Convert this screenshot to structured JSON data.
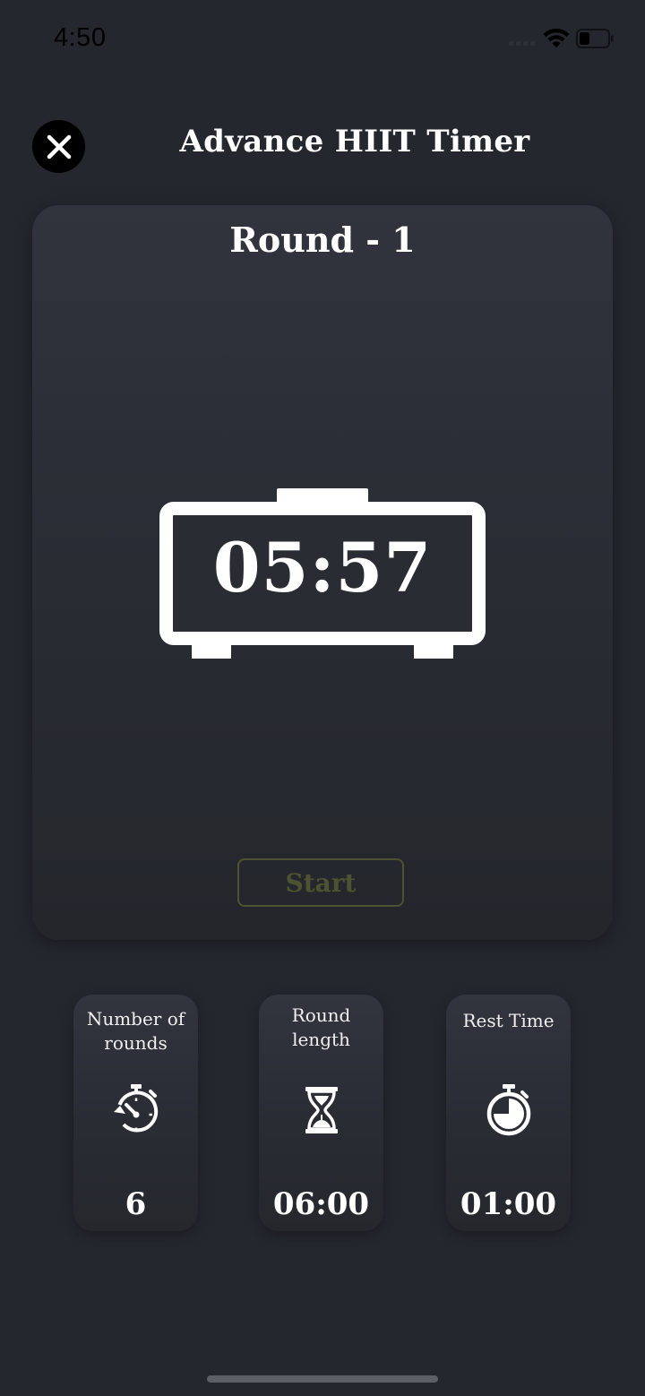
{
  "status_bar": {
    "time": "4:50",
    "wifi_icon": "wifi-icon",
    "battery_icon": "battery-icon",
    "battery_level": 0.3
  },
  "header": {
    "title": "Advance HIIT Timer",
    "close_icon": "close-icon"
  },
  "timer": {
    "round_label": "Round - 1",
    "display": "05:57",
    "clock_icon": "alarm-clock-icon",
    "start_label": "Start",
    "start_color": "#4d5330"
  },
  "settings": [
    {
      "label": "Number of\nrounds",
      "icon": "stopwatch-reset-icon",
      "value": "6"
    },
    {
      "label": "Round\nlength",
      "icon": "hourglass-icon",
      "value": "06:00"
    },
    {
      "label": "Rest Time",
      "icon": "stopwatch-icon",
      "value": "01:00"
    }
  ],
  "colors": {
    "background": "#25272f",
    "card": "#2f313a",
    "accent_start": "#4d5330"
  }
}
